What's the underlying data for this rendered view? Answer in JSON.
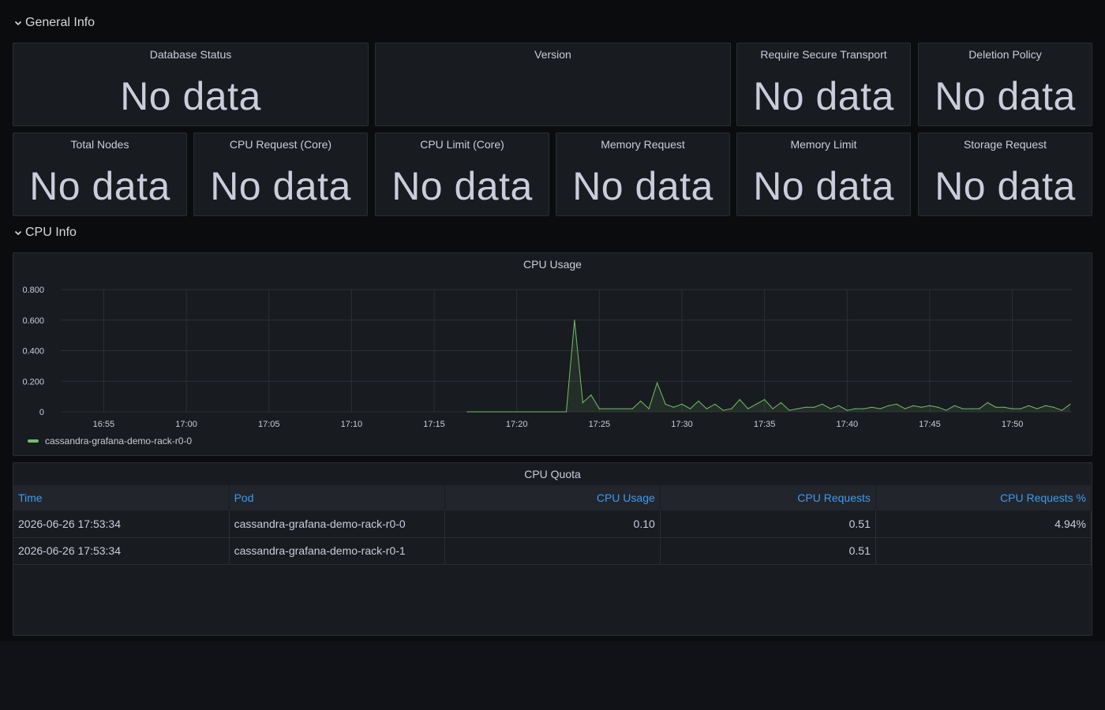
{
  "rows": {
    "general": {
      "label": "General Info"
    },
    "cpu": {
      "label": "CPU Info"
    }
  },
  "stats": {
    "database_status": {
      "title": "Database Status",
      "value": "No data"
    },
    "version": {
      "title": "Version",
      "value": ""
    },
    "require_secure_transport": {
      "title": "Require Secure Transport",
      "value": "No data"
    },
    "deletion_policy": {
      "title": "Deletion Policy",
      "value": "No data"
    },
    "total_nodes": {
      "title": "Total Nodes",
      "value": "No data"
    },
    "cpu_request": {
      "title": "CPU Request (Core)",
      "value": "No data"
    },
    "cpu_limit": {
      "title": "CPU Limit (Core)",
      "value": "No data"
    },
    "memory_request": {
      "title": "Memory Request",
      "value": "No data"
    },
    "memory_limit": {
      "title": "Memory Limit",
      "value": "No data"
    },
    "storage_request": {
      "title": "Storage Request",
      "value": "No data"
    }
  },
  "cpu_usage_panel": {
    "title": "CPU Usage"
  },
  "chart_data": {
    "type": "area",
    "title": "CPU Usage",
    "xlabel": "",
    "ylabel": "",
    "ylim": [
      0,
      0.8
    ],
    "yticks": [
      "0",
      "0.200",
      "0.400",
      "0.600",
      "0.800"
    ],
    "xticks": [
      "16:55",
      "17:00",
      "17:05",
      "17:10",
      "17:15",
      "17:20",
      "17:25",
      "17:30",
      "17:35",
      "17:40",
      "17:45",
      "17:50"
    ],
    "grid": true,
    "legend": "bottom-left",
    "color": "#73bf69",
    "series": [
      {
        "name": "cassandra-grafana-demo-rack-r0-0",
        "x": [
          "17:17:00",
          "17:23:00",
          "17:23:30",
          "17:24:00",
          "17:24:30",
          "17:25:00",
          "17:27:00",
          "17:27:30",
          "17:28:00",
          "17:28:30",
          "17:29:00",
          "17:29:30",
          "17:30:00",
          "17:30:30",
          "17:31:00",
          "17:31:30",
          "17:32:00",
          "17:32:30",
          "17:33:00",
          "17:33:30",
          "17:34:00",
          "17:34:30",
          "17:35:00",
          "17:35:30",
          "17:36:00",
          "17:36:30",
          "17:37:00",
          "17:37:30",
          "17:38:00",
          "17:38:30",
          "17:39:00",
          "17:39:30",
          "17:40:00",
          "17:40:30",
          "17:41:00",
          "17:41:30",
          "17:42:00",
          "17:42:30",
          "17:43:00",
          "17:43:30",
          "17:44:00",
          "17:44:30",
          "17:45:00",
          "17:45:30",
          "17:46:00",
          "17:46:30",
          "17:47:00",
          "17:47:30",
          "17:48:00",
          "17:48:30",
          "17:49:00",
          "17:49:30",
          "17:50:00",
          "17:50:30",
          "17:51:00",
          "17:51:30",
          "17:52:00",
          "17:52:30",
          "17:53:00",
          "17:53:30"
        ],
        "y": [
          0.0,
          0.0,
          0.6,
          0.06,
          0.11,
          0.02,
          0.02,
          0.07,
          0.02,
          0.19,
          0.05,
          0.03,
          0.05,
          0.02,
          0.07,
          0.02,
          0.05,
          0.01,
          0.02,
          0.08,
          0.02,
          0.05,
          0.08,
          0.02,
          0.06,
          0.01,
          0.02,
          0.03,
          0.03,
          0.05,
          0.02,
          0.04,
          0.01,
          0.02,
          0.02,
          0.03,
          0.02,
          0.04,
          0.05,
          0.02,
          0.04,
          0.03,
          0.04,
          0.03,
          0.01,
          0.04,
          0.02,
          0.02,
          0.02,
          0.06,
          0.03,
          0.03,
          0.02,
          0.02,
          0.04,
          0.02,
          0.04,
          0.03,
          0.01,
          0.05
        ]
      }
    ]
  },
  "cpu_quota_panel": {
    "title": "CPU Quota",
    "columns": [
      "Time",
      "Pod",
      "CPU Usage",
      "CPU Requests",
      "CPU Requests %"
    ],
    "rows": [
      [
        "2026-06-26 17:53:34",
        "cassandra-grafana-demo-rack-r0-0",
        "0.10",
        "0.51",
        "4.94%"
      ],
      [
        "2026-06-26 17:53:34",
        "cassandra-grafana-demo-rack-r0-1",
        "",
        "0.51",
        ""
      ]
    ]
  }
}
